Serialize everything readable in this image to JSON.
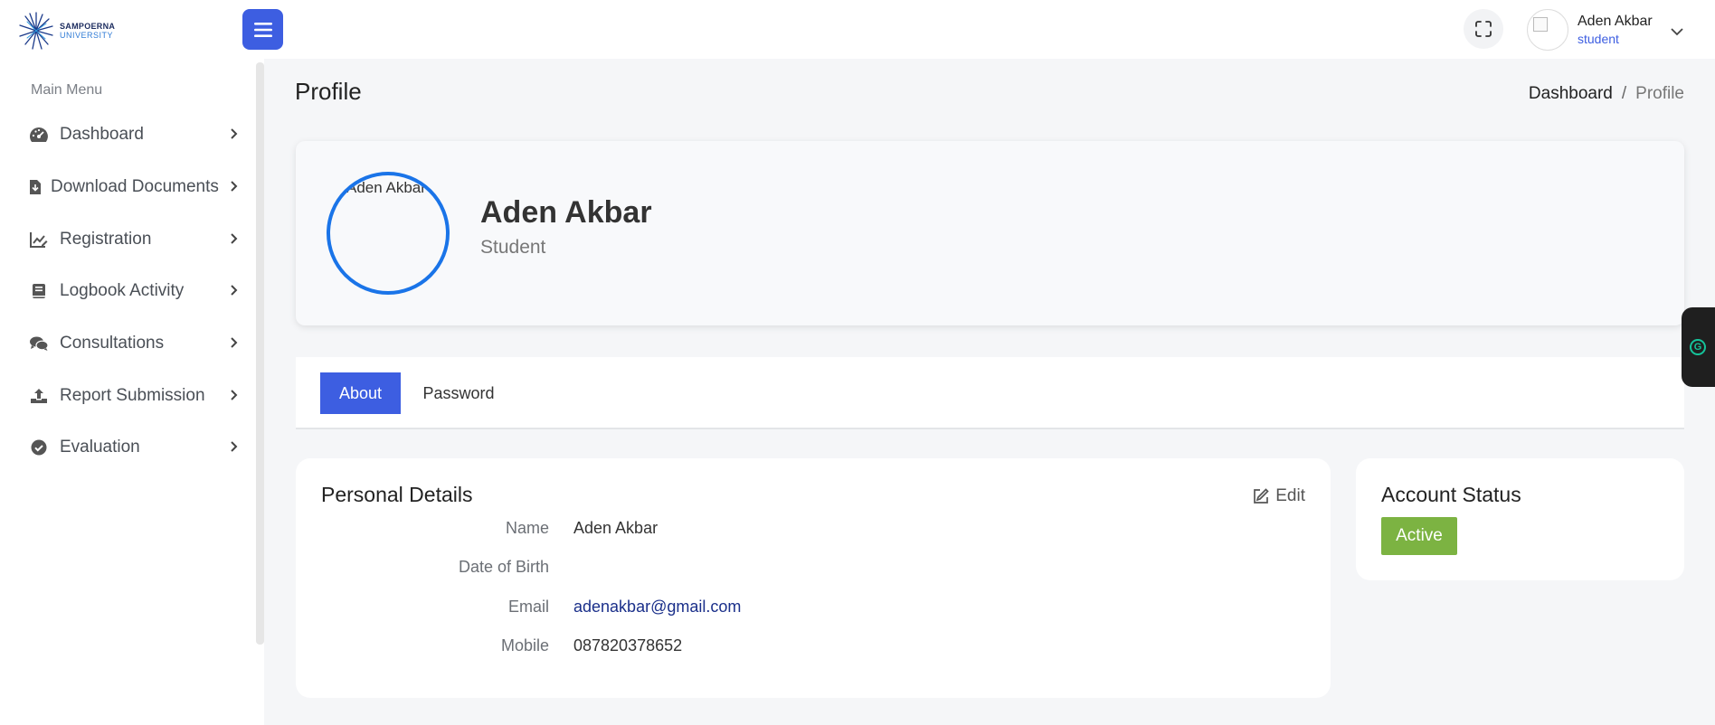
{
  "brand": {
    "line1": "SAMPOERNA",
    "line2": "UNIVERSITY"
  },
  "header": {
    "menu_icon": "hamburger-icon",
    "fullscreen_icon": "fullscreen-icon",
    "user": {
      "name": "Aden Akbar",
      "role": "student"
    }
  },
  "sidebar": {
    "title": "Main Menu",
    "items": [
      {
        "label": "Dashboard",
        "icon": "speedometer-icon"
      },
      {
        "label": "Download Documents",
        "icon": "file-download-icon"
      },
      {
        "label": "Registration",
        "icon": "chart-edit-icon"
      },
      {
        "label": "Logbook Activity",
        "icon": "book-icon"
      },
      {
        "label": "Consultations",
        "icon": "chat-bubbles-icon"
      },
      {
        "label": "Report Submission",
        "icon": "upload-icon"
      },
      {
        "label": "Evaluation",
        "icon": "check-circle-icon"
      }
    ]
  },
  "page": {
    "title": "Profile",
    "breadcrumb": {
      "home": "Dashboard",
      "separator": "/",
      "current": "Profile"
    }
  },
  "profile": {
    "image_alt": "Aden Akbar",
    "name": "Aden Akbar",
    "role": "Student"
  },
  "tabs": [
    {
      "label": "About",
      "active": true
    },
    {
      "label": "Password",
      "active": false
    }
  ],
  "personal_details": {
    "title": "Personal Details",
    "edit_label": "Edit",
    "rows": [
      {
        "label": "Name",
        "value": "Aden Akbar"
      },
      {
        "label": "Date of Birth",
        "value": ""
      },
      {
        "label": "Email",
        "value": "adenakbar@gmail.com"
      },
      {
        "label": "Mobile",
        "value": "087820378652"
      }
    ]
  },
  "account_status": {
    "title": "Account Status",
    "status": "Active",
    "status_color": "#7cb342"
  },
  "colors": {
    "primary": "#3d5ee1",
    "profile_ring": "#1a74e8",
    "link": "#1a2f8a"
  }
}
